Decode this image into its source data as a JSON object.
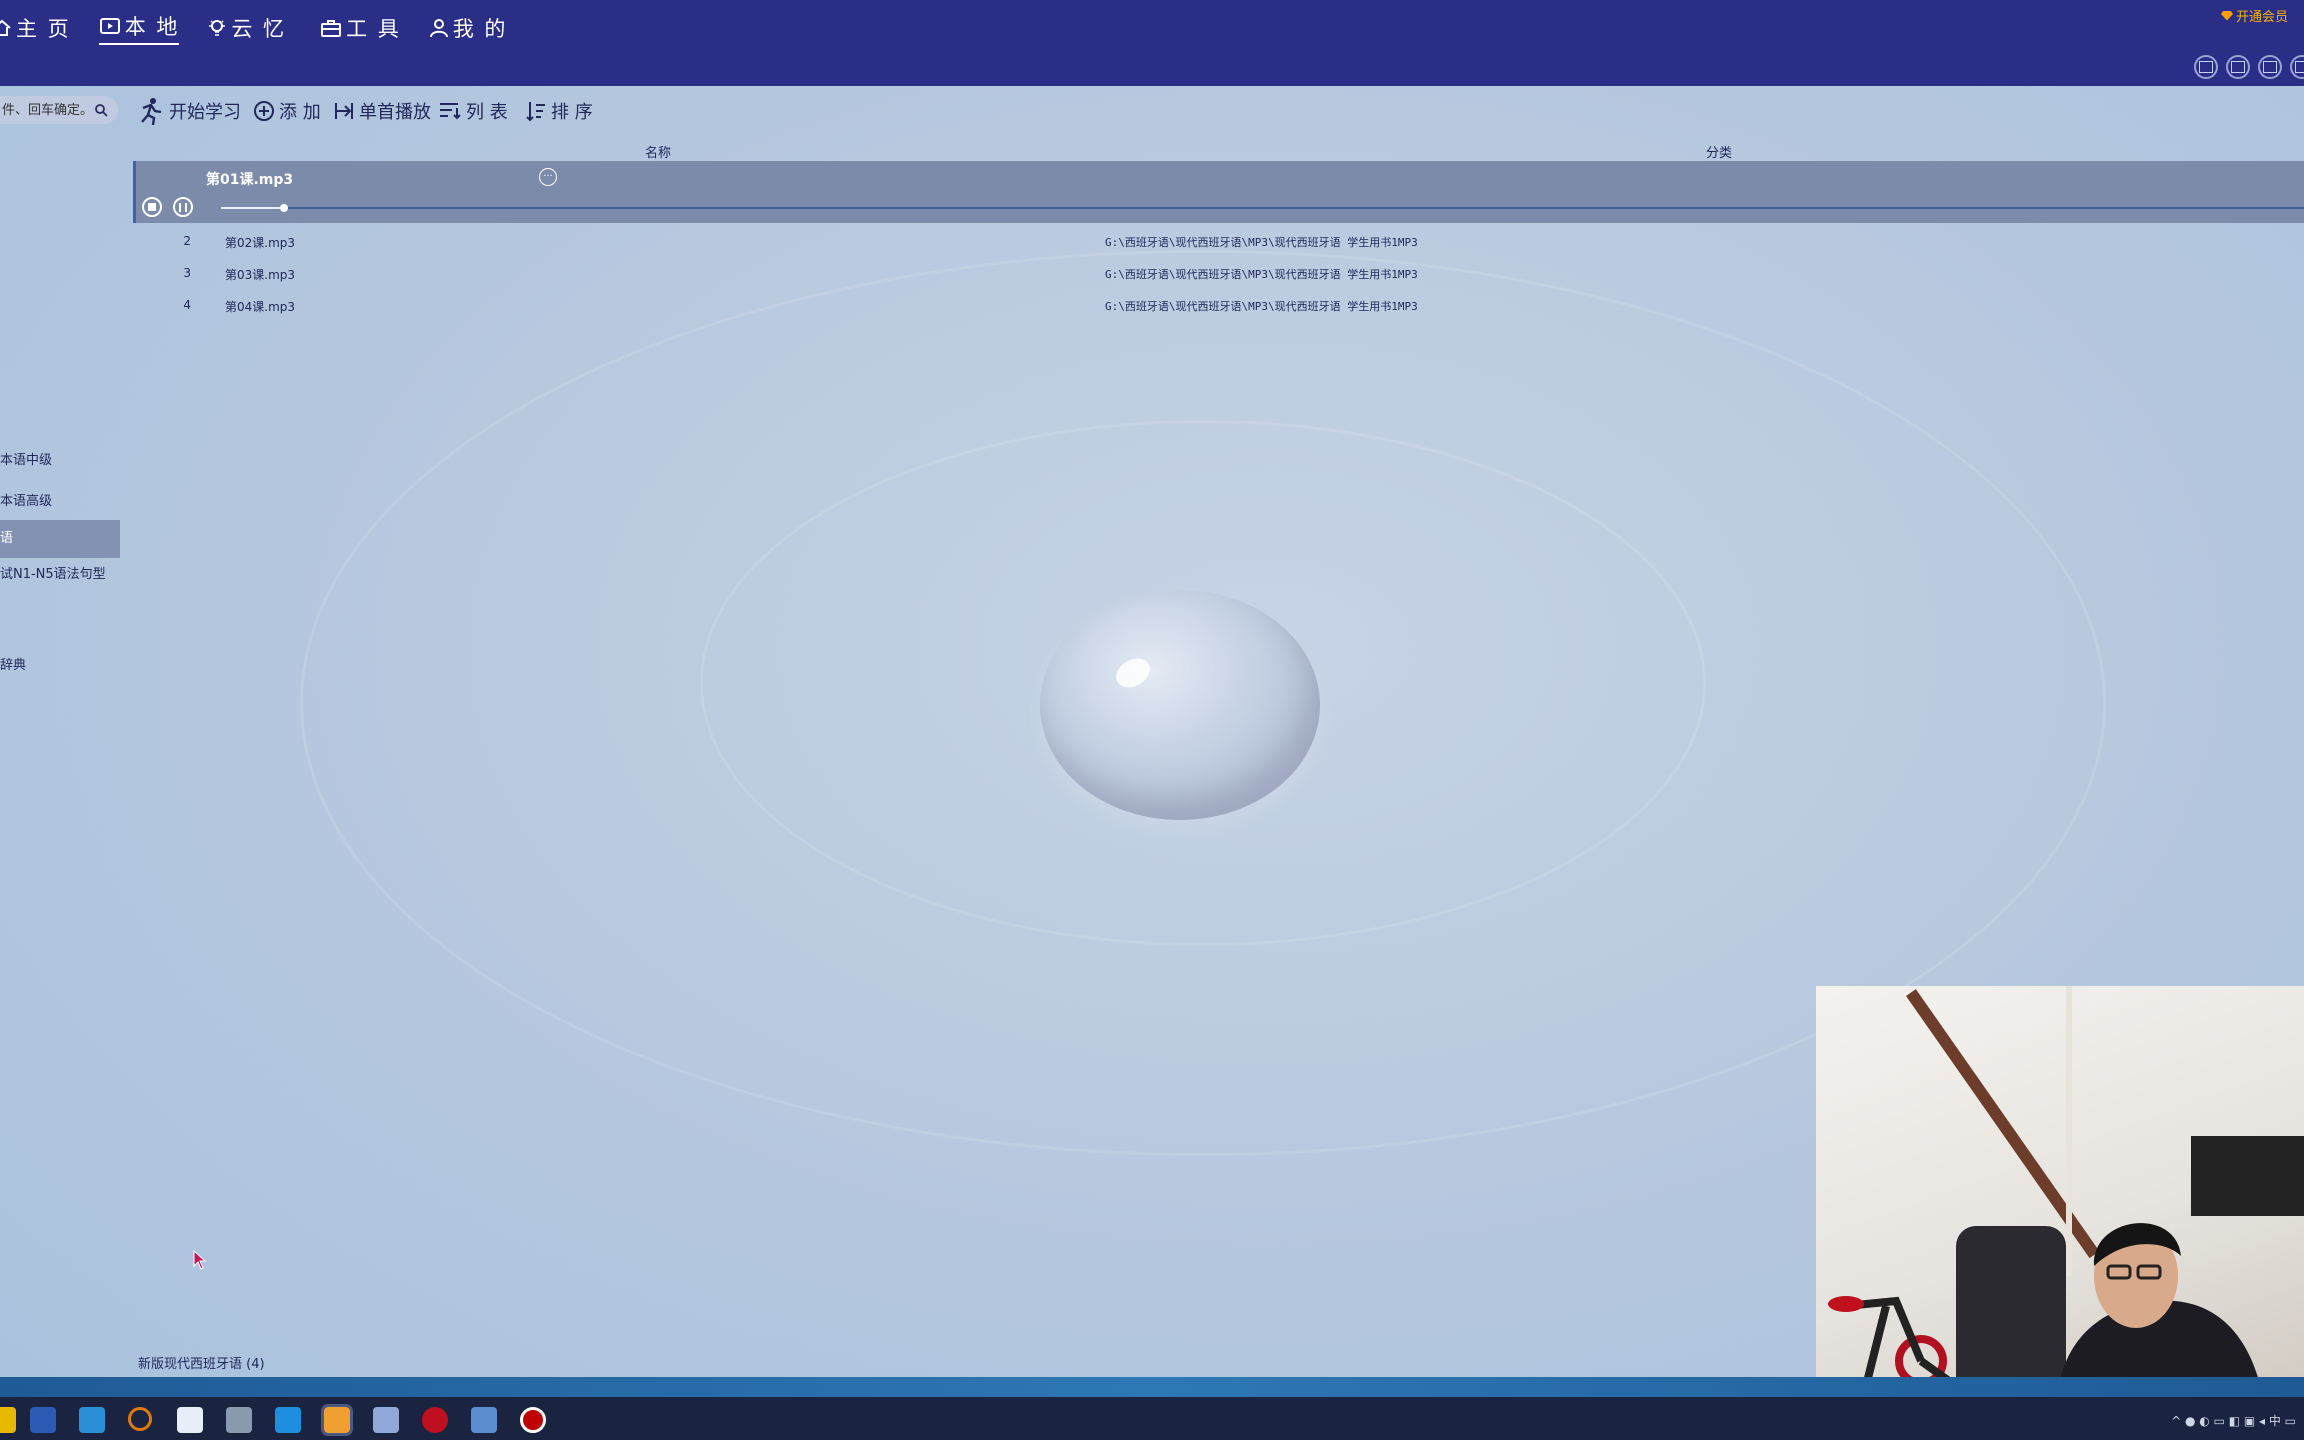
{
  "nav": {
    "items": [
      {
        "label": "主 页",
        "icon": "home-icon"
      },
      {
        "label": "本 地",
        "icon": "local-video-icon"
      },
      {
        "label": "云 忆",
        "icon": "lightbulb-icon"
      },
      {
        "label": "工 具",
        "icon": "toolbox-icon"
      },
      {
        "label": "我 的",
        "icon": "user-icon"
      }
    ],
    "vip_label": "开通会员"
  },
  "toolbar": {
    "search_placeholder": "件、回车确定。",
    "start_label": "开始学习",
    "add_label": "添 加",
    "single_play_label": "单首播放",
    "list_label": "列 表",
    "sort_label": "排 序"
  },
  "table": {
    "columns": [
      "名称",
      "分类"
    ],
    "playing": {
      "title": "第01课.mp3",
      "progress": 0.03
    },
    "rows": [
      {
        "num": "2",
        "name": "第02课.mp3",
        "path": "G:\\西班牙语\\现代西班牙语\\MP3\\现代西班牙语 学生用书1MP3"
      },
      {
        "num": "3",
        "name": "第03课.mp3",
        "path": "G:\\西班牙语\\现代西班牙语\\MP3\\现代西班牙语 学生用书1MP3"
      },
      {
        "num": "4",
        "name": "第04课.mp3",
        "path": "G:\\西班牙语\\现代西班牙语\\MP3\\现代西班牙语 学生用书1MP3"
      }
    ]
  },
  "sidebar": {
    "items": [
      {
        "label": "本语中级"
      },
      {
        "label": "本语高级"
      },
      {
        "label": "语"
      },
      {
        "label": "试N1-N5语法句型"
      },
      {
        "label": "辞典"
      }
    ]
  },
  "footer": {
    "count_label": "新版现代西班牙语 (4)"
  }
}
